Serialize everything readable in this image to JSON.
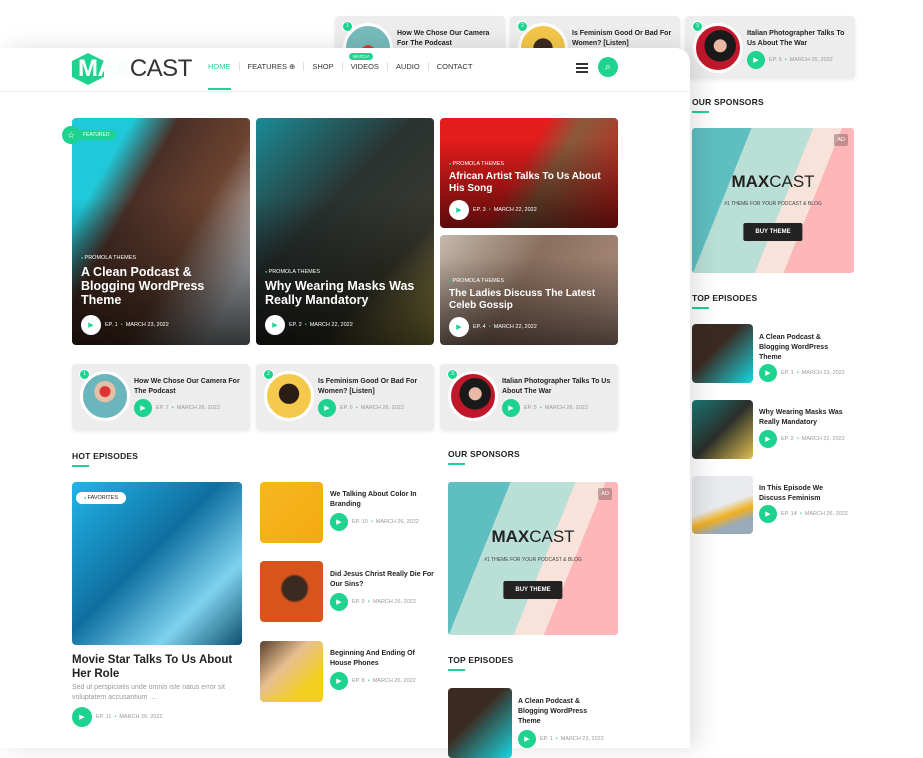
{
  "brand": {
    "logo_bold": "MAX",
    "logo_light": "CAST",
    "accent": "#1ed38f"
  },
  "nav": {
    "items": [
      "HOME",
      "FEATURES ⊕",
      "SHOP",
      "VIDEOS",
      "AUDIO",
      "CONTACT"
    ],
    "videos_badge": "WATCH"
  },
  "icons": {
    "menu": "menu-lines-icon",
    "search": "search-icon",
    "play": "play-icon",
    "featured": "star-icon"
  },
  "hero": [
    {
      "category": "PROMOLA THEMES",
      "title": "A Clean Podcast & Blogging WordPress Theme",
      "ep": "EP. 1",
      "date": "MARCH 23, 2022",
      "tag": "FEATURED"
    },
    {
      "category": "PROMOLA THEMES",
      "title": "Why Wearing Masks Was Really Mandatory",
      "ep": "EP. 2",
      "date": "MARCH 22, 2022"
    },
    {
      "category": "PROMOLA THEMES",
      "title": "African Artist Talks To Us About His Song",
      "ep": "EP. 3",
      "date": "MARCH 22, 2022"
    },
    {
      "category": "PROMOLA THEMES",
      "title": "The Ladies Discuss The Latest Celeb Gossip",
      "ep": "EP. 4",
      "date": "MARCH 22, 2022"
    }
  ],
  "ranked": [
    {
      "num": "1",
      "title": "How We Chose Our Camera For The Podcast",
      "ep": "EP. 7",
      "date": "MARCH 26, 2022"
    },
    {
      "num": "2",
      "title": "Is Feminism Good Or Bad For Women? [Listen]",
      "ep": "EP. 6",
      "date": "MARCH 26, 2022"
    },
    {
      "num": "3",
      "title": "Italian Photographer Talks To Us About The War",
      "ep": "EP. 5",
      "date": "MARCH 26, 2022"
    }
  ],
  "hot": {
    "heading": "HOT EPISODES",
    "big": {
      "tag": "FAVORITES",
      "title": "Movie Star Talks To Us About Her Role",
      "excerpt": "Sed ut perspiciatis unde omnis iste natus error sit voluptatem accusantium ....",
      "ep": "EP. 11",
      "date": "MARCH 26, 2022"
    },
    "list": [
      {
        "title": "We Talking About Color In Branding",
        "ep": "EP. 10",
        "date": "MARCH 26, 2022"
      },
      {
        "title": "Did Jesus Christ Really Die For Our Sins?",
        "ep": "EP. 9",
        "date": "MARCH 26, 2022"
      },
      {
        "title": "Beginning And Ending Of House Phones",
        "ep": "EP. 8",
        "date": "MARCH 26, 2022"
      }
    ]
  },
  "sponsors": {
    "heading": "OUR SPONSORS",
    "ad_label": "AD",
    "logo_bold": "MAX",
    "logo_light": "CAST",
    "tagline": "#1 THEME FOR YOUR PODCAST & BLOG",
    "button": "BUY THEME"
  },
  "top": {
    "heading": "TOP EPISODES",
    "items": [
      {
        "title": "A Clean Podcast & Blogging WordPress Theme",
        "ep": "EP. 1",
        "date": "MARCH 23, 2022"
      },
      {
        "title": "Why Wearing Masks Was Really Mandatory",
        "ep": "EP. 2",
        "date": "MARCH 22, 2022"
      },
      {
        "title": "In This Episode We Discuss Feminism",
        "ep": "EP. 14",
        "date": "MARCH 26, 2022"
      }
    ]
  }
}
